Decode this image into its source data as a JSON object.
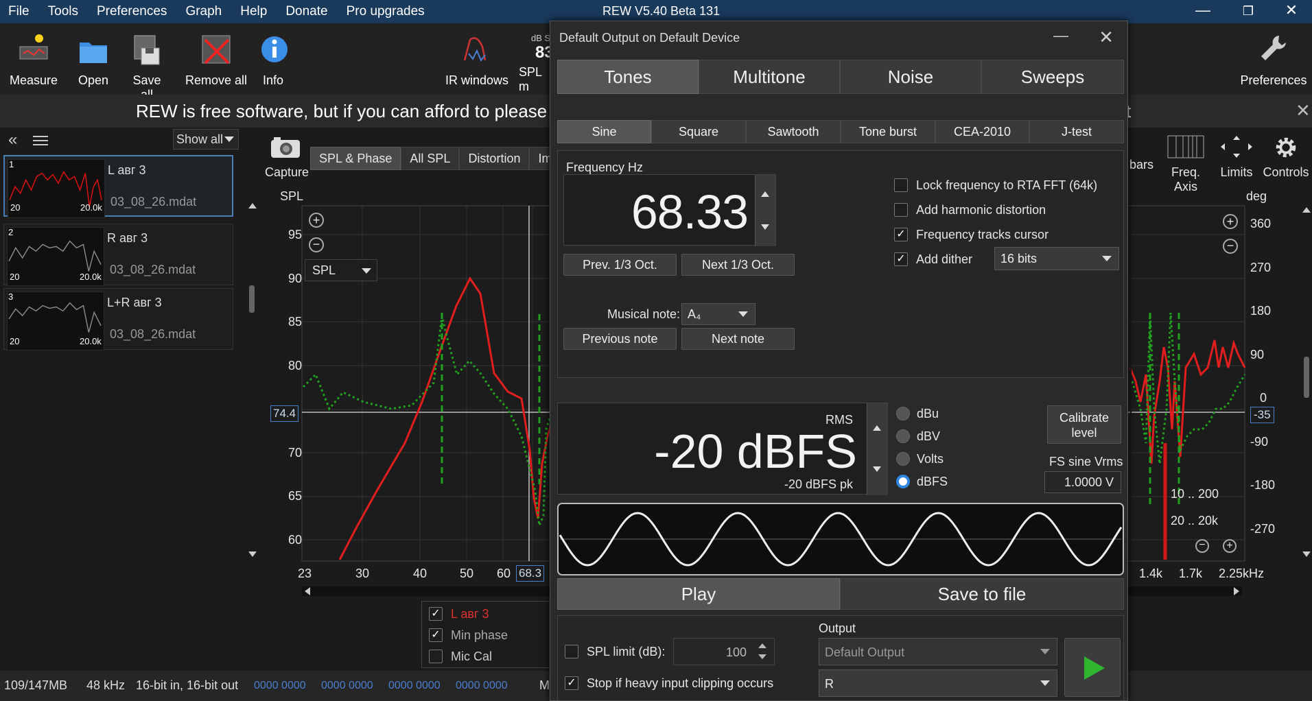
{
  "window": {
    "title": "REW V5.40 Beta 131",
    "minimize": "—",
    "restore": "❐",
    "close": "✕"
  },
  "menu": [
    "File",
    "Tools",
    "Preferences",
    "Graph",
    "Help",
    "Donate",
    "Pro upgrades"
  ],
  "toolbar": {
    "measure": "Measure",
    "open": "Open",
    "save_all": "Save all",
    "remove_all": "Remove all",
    "info": "Info",
    "ir_windows": "IR windows",
    "spl": "SPL m",
    "spl_db_label": "dB S",
    "spl_value": "83",
    "preferences": "Preferences"
  },
  "banner": {
    "text_left": "REW is free software, but if you can afford to please",
    "text_right": "ent",
    "close": "✕"
  },
  "left_panel": {
    "show_all": "Show all",
    "measurements": [
      {
        "num": "1",
        "name": "L авг 3",
        "file": "03_08_26.mdat",
        "x_start": "20",
        "x_end": "20.0k",
        "color": "#d11"
      },
      {
        "num": "2",
        "name": "R авг 3",
        "file": "03_08_26.mdat",
        "x_start": "20",
        "x_end": "20.0k",
        "color": "#888"
      },
      {
        "num": "3",
        "name": "L+R авг 3",
        "file": "03_08_26.mdat",
        "x_start": "20",
        "x_end": "20.0k",
        "color": "#888"
      }
    ]
  },
  "graph_tabs": {
    "capture": "Capture",
    "tabs": [
      "SPL & Phase",
      "All SPL",
      "Distortion",
      "Impu"
    ],
    "bars": "bars",
    "freq_axis": "Freq. Axis",
    "limits": "Limits",
    "controls": "Controls"
  },
  "graph": {
    "y_label": "SPL",
    "y_ticks": [
      "95",
      "90",
      "85",
      "80",
      "75",
      "70",
      "65",
      "60"
    ],
    "y_cursor": "74.4",
    "phase_label": "deg",
    "phase_ticks": [
      "360",
      "270",
      "180",
      "90",
      "0",
      "-90",
      "-180",
      "-270"
    ],
    "phase_cursor": "-35",
    "x_ticks": [
      "23",
      "30",
      "40",
      "50",
      "60"
    ],
    "x_cursor": "68.3",
    "x_ticks_right": [
      "1.4k",
      "1.7k",
      "2.25kHz"
    ],
    "dropdown": "SPL",
    "range1": "10 .. 200",
    "range2": "20 .. 20k",
    "legend": [
      {
        "label": "L авг 3",
        "checked": true,
        "color": "#e03030"
      },
      {
        "label": "Min phase",
        "checked": true,
        "color": "#aaa"
      },
      {
        "label": "Mic Cal",
        "checked": false,
        "color": "#ccc"
      }
    ]
  },
  "status": {
    "memory": "109/147MB",
    "rate": "48 kHz",
    "bits": "16-bit in, 16-bit out",
    "counters": [
      "0000 0000",
      "0000 0000",
      "0000 0000",
      "0000 0000"
    ],
    "trail": "M"
  },
  "dialog": {
    "title": "Default Output on Default Device",
    "main_tabs": [
      "Tones",
      "Multitone",
      "Noise",
      "Sweeps"
    ],
    "sub_tabs": [
      "Sine",
      "Square",
      "Sawtooth",
      "Tone burst",
      "CEA-2010",
      "J-test"
    ],
    "frequency_label": "Frequency Hz",
    "frequency": "68.33",
    "prev_oct": "Prev. 1/3 Oct.",
    "next_oct": "Next 1/3 Oct.",
    "musical_note_label": "Musical note:",
    "musical_note": "A₄",
    "previous_note": "Previous note",
    "next_note": "Next note",
    "lock_fft": "Lock frequency to RTA FFT (64k)",
    "add_harmonic": "Add harmonic distortion",
    "freq_tracks": "Frequency tracks cursor",
    "add_dither": "Add dither",
    "dither_bits": "16 bits",
    "rms_label": "RMS",
    "level": "-20 dBFS",
    "level_pk": "-20 dBFS pk",
    "units": [
      "dBu",
      "dBV",
      "Volts",
      "dBFS"
    ],
    "calibrate": "Calibrate level",
    "fs_sine_label": "FS sine Vrms",
    "fs_sine": "1.0000 V",
    "play": "Play",
    "save_file": "Save to file",
    "output_label": "Output",
    "spl_limit": "SPL limit (dB):",
    "spl_limit_value": "100",
    "stop_clip": "Stop if heavy input clipping occurs",
    "output_device": "Default Output",
    "channel": "R"
  }
}
